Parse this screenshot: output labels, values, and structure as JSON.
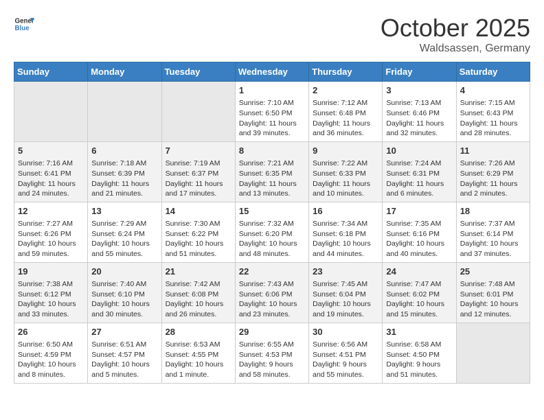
{
  "header": {
    "logo_general": "General",
    "logo_blue": "Blue",
    "month": "October 2025",
    "location": "Waldsassen, Germany"
  },
  "days_of_week": [
    "Sunday",
    "Monday",
    "Tuesday",
    "Wednesday",
    "Thursday",
    "Friday",
    "Saturday"
  ],
  "weeks": [
    [
      {
        "day": "",
        "content": ""
      },
      {
        "day": "",
        "content": ""
      },
      {
        "day": "",
        "content": ""
      },
      {
        "day": "1",
        "content": "Sunrise: 7:10 AM\nSunset: 6:50 PM\nDaylight: 11 hours and 39 minutes."
      },
      {
        "day": "2",
        "content": "Sunrise: 7:12 AM\nSunset: 6:48 PM\nDaylight: 11 hours and 36 minutes."
      },
      {
        "day": "3",
        "content": "Sunrise: 7:13 AM\nSunset: 6:46 PM\nDaylight: 11 hours and 32 minutes."
      },
      {
        "day": "4",
        "content": "Sunrise: 7:15 AM\nSunset: 6:43 PM\nDaylight: 11 hours and 28 minutes."
      }
    ],
    [
      {
        "day": "5",
        "content": "Sunrise: 7:16 AM\nSunset: 6:41 PM\nDaylight: 11 hours and 24 minutes."
      },
      {
        "day": "6",
        "content": "Sunrise: 7:18 AM\nSunset: 6:39 PM\nDaylight: 11 hours and 21 minutes."
      },
      {
        "day": "7",
        "content": "Sunrise: 7:19 AM\nSunset: 6:37 PM\nDaylight: 11 hours and 17 minutes."
      },
      {
        "day": "8",
        "content": "Sunrise: 7:21 AM\nSunset: 6:35 PM\nDaylight: 11 hours and 13 minutes."
      },
      {
        "day": "9",
        "content": "Sunrise: 7:22 AM\nSunset: 6:33 PM\nDaylight: 11 hours and 10 minutes."
      },
      {
        "day": "10",
        "content": "Sunrise: 7:24 AM\nSunset: 6:31 PM\nDaylight: 11 hours and 6 minutes."
      },
      {
        "day": "11",
        "content": "Sunrise: 7:26 AM\nSunset: 6:29 PM\nDaylight: 11 hours and 2 minutes."
      }
    ],
    [
      {
        "day": "12",
        "content": "Sunrise: 7:27 AM\nSunset: 6:26 PM\nDaylight: 10 hours and 59 minutes."
      },
      {
        "day": "13",
        "content": "Sunrise: 7:29 AM\nSunset: 6:24 PM\nDaylight: 10 hours and 55 minutes."
      },
      {
        "day": "14",
        "content": "Sunrise: 7:30 AM\nSunset: 6:22 PM\nDaylight: 10 hours and 51 minutes."
      },
      {
        "day": "15",
        "content": "Sunrise: 7:32 AM\nSunset: 6:20 PM\nDaylight: 10 hours and 48 minutes."
      },
      {
        "day": "16",
        "content": "Sunrise: 7:34 AM\nSunset: 6:18 PM\nDaylight: 10 hours and 44 minutes."
      },
      {
        "day": "17",
        "content": "Sunrise: 7:35 AM\nSunset: 6:16 PM\nDaylight: 10 hours and 40 minutes."
      },
      {
        "day": "18",
        "content": "Sunrise: 7:37 AM\nSunset: 6:14 PM\nDaylight: 10 hours and 37 minutes."
      }
    ],
    [
      {
        "day": "19",
        "content": "Sunrise: 7:38 AM\nSunset: 6:12 PM\nDaylight: 10 hours and 33 minutes."
      },
      {
        "day": "20",
        "content": "Sunrise: 7:40 AM\nSunset: 6:10 PM\nDaylight: 10 hours and 30 minutes."
      },
      {
        "day": "21",
        "content": "Sunrise: 7:42 AM\nSunset: 6:08 PM\nDaylight: 10 hours and 26 minutes."
      },
      {
        "day": "22",
        "content": "Sunrise: 7:43 AM\nSunset: 6:06 PM\nDaylight: 10 hours and 23 minutes."
      },
      {
        "day": "23",
        "content": "Sunrise: 7:45 AM\nSunset: 6:04 PM\nDaylight: 10 hours and 19 minutes."
      },
      {
        "day": "24",
        "content": "Sunrise: 7:47 AM\nSunset: 6:02 PM\nDaylight: 10 hours and 15 minutes."
      },
      {
        "day": "25",
        "content": "Sunrise: 7:48 AM\nSunset: 6:01 PM\nDaylight: 10 hours and 12 minutes."
      }
    ],
    [
      {
        "day": "26",
        "content": "Sunrise: 6:50 AM\nSunset: 4:59 PM\nDaylight: 10 hours and 8 minutes."
      },
      {
        "day": "27",
        "content": "Sunrise: 6:51 AM\nSunset: 4:57 PM\nDaylight: 10 hours and 5 minutes."
      },
      {
        "day": "28",
        "content": "Sunrise: 6:53 AM\nSunset: 4:55 PM\nDaylight: 10 hours and 1 minute."
      },
      {
        "day": "29",
        "content": "Sunrise: 6:55 AM\nSunset: 4:53 PM\nDaylight: 9 hours and 58 minutes."
      },
      {
        "day": "30",
        "content": "Sunrise: 6:56 AM\nSunset: 4:51 PM\nDaylight: 9 hours and 55 minutes."
      },
      {
        "day": "31",
        "content": "Sunrise: 6:58 AM\nSunset: 4:50 PM\nDaylight: 9 hours and 51 minutes."
      },
      {
        "day": "",
        "content": ""
      }
    ]
  ]
}
